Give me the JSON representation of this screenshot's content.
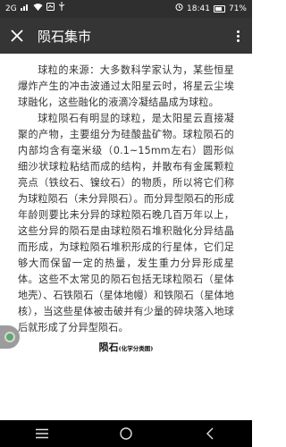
{
  "status_bar": {
    "signal": "2G",
    "time": "18:41",
    "battery": "71%"
  },
  "header": {
    "title": "陨石集市"
  },
  "article": {
    "paragraphs": [
      "球粒的来源：大多数科学家认为，某些恒星爆炸产生的冲击波通过太阳星云时，将星云尘埃球融化，这些融化的液滴冷凝结晶成为球粒。",
      "球粒陨石有明显的球粒，是太阳星云直接凝聚的产物，主要组分为硅酸盐矿物。球粒陨石的内部均含有毫米级（0.1~15mm左右）圆形似细沙状球粒粘结而成的结构，并散布有金属颗粒亮点（铁纹石、镍纹石）的物质，所以将它们称为球粒陨石（未分异陨石）。而分异型陨石的形成年龄则要比未分异的球粒陨石晚几百万年以上，这些分异的陨石是由球粒陨石堆积融化分异结晶而形成，为球粒陨石堆积形成的行星体，它们足够大而保留一定的热量，发生重力分异形成星体。这些不太常见的陨石包括无球粒陨石（星体地壳）、石铁陨石（星体地幔）和铁陨石（星体地核），当这些星体被击破并有少量的碎块落入地球后就形成了分异型陨石。"
    ],
    "caption_main": "陨石",
    "caption_sub": "(化学分类图)"
  },
  "nav_bar": {
    "items": [
      "menu-icon",
      "home-icon",
      "back-icon"
    ]
  }
}
